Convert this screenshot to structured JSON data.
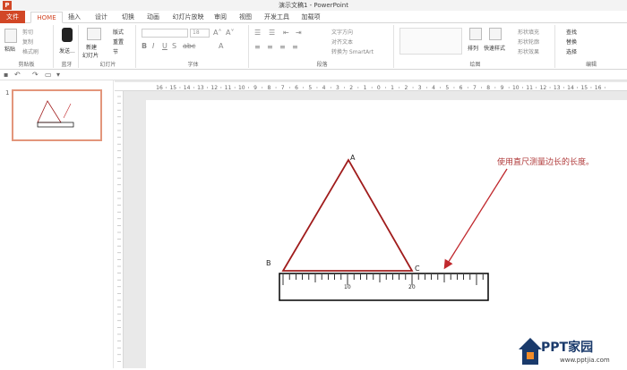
{
  "window": {
    "app_icon": "P",
    "title": "演示文稿1 - PowerPoint"
  },
  "tabs": [
    {
      "label": "文件"
    },
    {
      "label": "HOME"
    },
    {
      "label": "插入"
    },
    {
      "label": "设计"
    },
    {
      "label": "切换"
    },
    {
      "label": "动画"
    },
    {
      "label": "幻灯片放映"
    },
    {
      "label": "审阅"
    },
    {
      "label": "视图"
    },
    {
      "label": "开发工具"
    },
    {
      "label": "加载项"
    }
  ],
  "ribbon": {
    "clipboard": {
      "paste": "粘贴",
      "cut": "剪切",
      "copy": "复制",
      "format_painter": "格式刷",
      "label": "剪贴板"
    },
    "bluetooth": {
      "send": "发送...",
      "label": "蓝牙"
    },
    "slides": {
      "new_slide": "新建",
      "new_slide2": "幻灯片",
      "layout": "版式",
      "reset": "重置",
      "section": "节",
      "label": "幻灯片"
    },
    "font": {
      "font_size": "18",
      "label": "字体"
    },
    "paragraph": {
      "text_direction": "文字方向",
      "align_text": "对齐文本",
      "smartart": "转换为 SmartArt",
      "label": "段落"
    },
    "drawing": {
      "arrange": "排列",
      "quick_styles": "快速样式",
      "shape_fill": "形状填充",
      "shape_outline": "形状轮廓",
      "shape_effects": "形状效果",
      "label": "绘图"
    },
    "editing": {
      "find": "查找",
      "replace": "替换",
      "select": "选择",
      "label": "编辑"
    }
  },
  "thumbnails": [
    {
      "number": "1"
    }
  ],
  "ruler_labels": [
    "16",
    "15",
    "14",
    "13",
    "12",
    "11",
    "10",
    "9",
    "8",
    "7",
    "6",
    "5",
    "4",
    "3",
    "2",
    "1",
    "0",
    "1",
    "2",
    "3",
    "4",
    "5",
    "6",
    "7",
    "8",
    "9",
    "10",
    "11",
    "12",
    "13",
    "14",
    "15",
    "16"
  ],
  "slide": {
    "vertex_a": "A",
    "vertex_b": "B",
    "vertex_c": "C",
    "ruler_tick_10": "10",
    "ruler_tick_20": "20",
    "annotation": "使用直尺测量边长的长度。",
    "colors": {
      "triangle": "#a01c1c",
      "arrow": "#c0282d",
      "ruler": "#000000"
    }
  },
  "watermark": {
    "brand": "PPT家园",
    "url": "www.pptjia.com"
  }
}
